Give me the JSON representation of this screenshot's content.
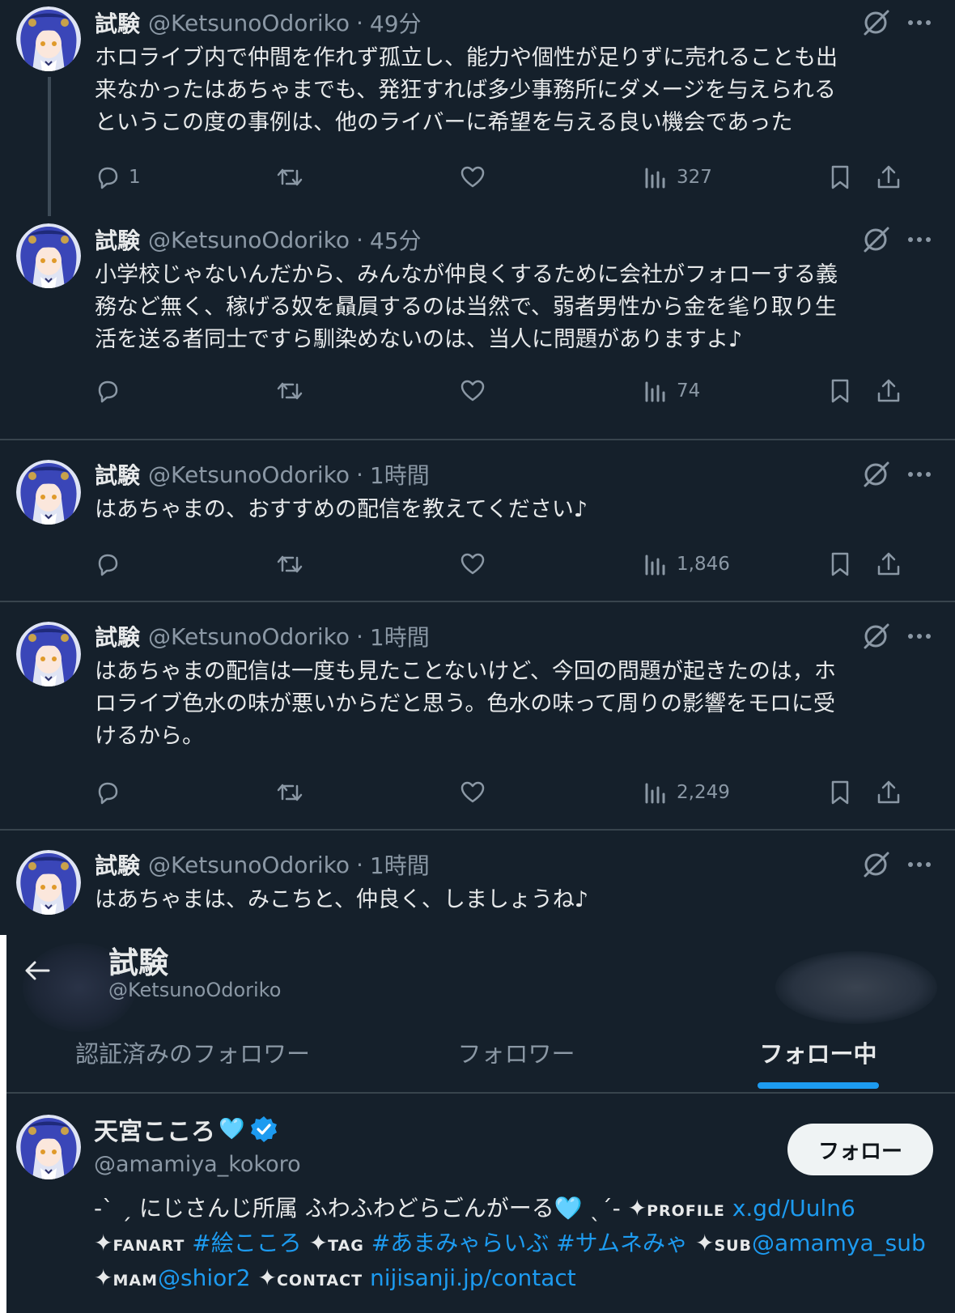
{
  "colors": {
    "background": "#15202b",
    "text": "#e7e9ea",
    "muted": "#8b98a5",
    "accent": "#1d9bf0",
    "divider": "#38444d"
  },
  "tweets": [
    {
      "name": "試験",
      "handle": "@KetsunoOdoriko",
      "separator": "·",
      "time": "49分",
      "lines": [
        "ホロライブ内で仲間を作れず孤立し、能力や個性が足りずに売れることも出",
        "来なかったはあちゃまでも、発狂すれば多少事務所にダメージを与えられる",
        "というこの度の事例は、他のライバーに希望を与える良い機会であった"
      ],
      "replies": "1",
      "views": "327"
    },
    {
      "name": "試験",
      "handle": "@KetsunoOdoriko",
      "separator": "·",
      "time": "45分",
      "lines": [
        "小学校じゃないんだから、みんなが仲良くするために会社がフォローする義",
        "務など無く、稼げる奴を贔屓するのは当然で、弱者男性から金を毟り取り生",
        "活を送る者同士ですら馴染めないのは、当人に問題がありますよ♪"
      ],
      "replies": "",
      "views": "74"
    },
    {
      "name": "試験",
      "handle": "@KetsunoOdoriko",
      "separator": "·",
      "time": "1時間",
      "lines": [
        "はあちゃまの、おすすめの配信を教えてください♪"
      ],
      "replies": "",
      "views": "1,846"
    },
    {
      "name": "試験",
      "handle": "@KetsunoOdoriko",
      "separator": "·",
      "time": "1時間",
      "lines": [
        "はあちゃまの配信は一度も見たことないけど、今回の問題が起きたのは，ホ",
        "ロライブ色水の味が悪いからだと思う。色水の味って周りの影響をモロに受",
        "けるから。"
      ],
      "replies": "",
      "views": "2,249"
    },
    {
      "name": "試験",
      "handle": "@KetsunoOdoriko",
      "separator": "·",
      "time": "1時間",
      "lines": [
        "はあちゃまは、みこちと、仲良く、しましょうね♪"
      ]
    }
  ],
  "icons": {
    "reply": "reply-icon",
    "retweet": "retweet-icon",
    "like": "heart-icon",
    "views": "views-chart-icon",
    "bookmark": "bookmark-icon",
    "share": "share-icon",
    "grok": "grok-icon",
    "more": "more-icon",
    "back": "back-arrow-icon",
    "verified": "verified-badge-icon"
  },
  "profile_header": {
    "name": "試験",
    "handle": "@KetsunoOdoriko"
  },
  "tabs": [
    {
      "label": "認証済みのフォロワー",
      "active": false
    },
    {
      "label": "フォロワー",
      "active": false
    },
    {
      "label": "フォロー中",
      "active": true
    }
  ],
  "user_card": {
    "name": "天宮こころ",
    "name_emoji": "🩵",
    "handle": "@amamiya_kokoro",
    "follow_button": "フォロー",
    "bio": {
      "l1_a": "-ˋ ˏ にじさんじ所属 ふわふわどらごんがーる",
      "l1_heart": "🩵",
      "l1_b": " ˎˊ- ",
      "star": "✦",
      "profile_tag": "PROFILE",
      "profile_link": "x.gd/Uuln6",
      "fanart_tag": "FANART",
      "fanart_link": "#絵こころ",
      "tag_tag": "TAG",
      "tag_link1": "#あまみゃらいぶ",
      "tag_link2": "#サムネみゃ",
      "sub_tag": "SUB",
      "sub_link": "@amamya_sub",
      "mam_tag": "MAM",
      "mam_link": "@shior2",
      "contact_tag": "CONTACT",
      "contact_link": "nijisanji.jp/contact"
    }
  }
}
